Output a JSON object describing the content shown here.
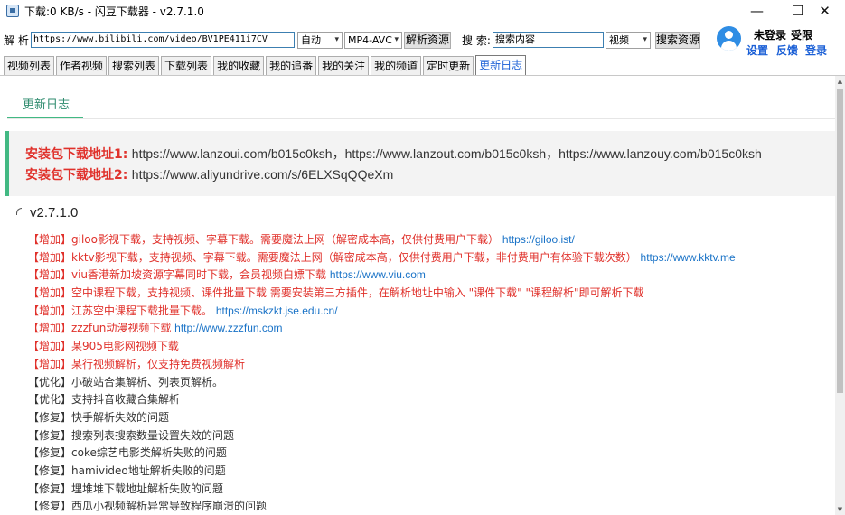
{
  "window": {
    "title": "下载:0 KB/s - 闪豆下载器 - v2.7.1.0",
    "minimize": "—",
    "maximize": "☐",
    "close": "✕"
  },
  "toolbar": {
    "parse_label": "解 析",
    "url_value": "https://www.bilibili.com/video/BV1PE411i7CV",
    "mode_select": "自动",
    "format_select": "MP4-AVC",
    "parse_button": "解析资源",
    "search_label": "搜 索:",
    "search_value": "搜索内容",
    "search_type_select": "视频",
    "search_button": "搜索资源"
  },
  "user": {
    "status": "未登录",
    "limit": "受限",
    "settings": "设置",
    "feedback": "反馈",
    "login": "登录"
  },
  "tabs": [
    {
      "label": "视频列表"
    },
    {
      "label": "作者视频"
    },
    {
      "label": "搜索列表"
    },
    {
      "label": "下载列表"
    },
    {
      "label": "我的收藏"
    },
    {
      "label": "我的追番"
    },
    {
      "label": "我的关注"
    },
    {
      "label": "我的频道"
    },
    {
      "label": "定时更新"
    },
    {
      "label": "更新日志",
      "active": true
    }
  ],
  "content": {
    "subtab": "更新日志",
    "download1_label": "安装包下载地址1:",
    "download1_links": "https://www.lanzoui.com/b015c0ksh，https://www.lanzout.com/b015c0ksh，https://www.lanzouy.com/b015c0ksh",
    "download2_label": "安装包下载地址2:",
    "download2_links": "https://www.aliyundrive.com/s/6ELXSqQQeXm",
    "version": "v2.7.1.0",
    "log": [
      {
        "type": "add",
        "text": "【增加】giloo影视下载，支持视频、字幕下载。需要魔法上网（解密成本高，仅供付费用户下载）",
        "url": "https://giloo.ist/"
      },
      {
        "type": "add",
        "text": "【增加】kktv影视下载，支持视频、字幕下载。需要魔法上网（解密成本高，仅供付费用户下载，非付费用户有体验下载次数）",
        "url": "https://www.kktv.me"
      },
      {
        "type": "add",
        "text": "【增加】viu香港新加坡资源字幕同时下载，会员视频白嫖下载",
        "url": "https://www.viu.com"
      },
      {
        "type": "add",
        "text": "【增加】空中课程下载，支持视频、课件批量下载 需要安装第三方插件，在解析地址中输入 \"课件下载\" \"课程解析\"即可解析下载",
        "url": ""
      },
      {
        "type": "add",
        "text": "【增加】江苏空中课程下载批量下载。",
        "url": "https://mskzkt.jse.edu.cn/"
      },
      {
        "type": "add",
        "text": "【增加】zzzfun动漫视频下载",
        "url": "http://www.zzzfun.com"
      },
      {
        "type": "add",
        "text": "【增加】某905电影网视频下载",
        "url": ""
      },
      {
        "type": "add",
        "text": "【增加】某行视频解析，仅支持免费视频解析",
        "url": ""
      },
      {
        "type": "other",
        "text": "【优化】小破站合集解析、列表页解析。",
        "url": ""
      },
      {
        "type": "other",
        "text": "【优化】支持抖音收藏合集解析",
        "url": ""
      },
      {
        "type": "other",
        "text": "【修复】快手解析失效的问题",
        "url": ""
      },
      {
        "type": "other",
        "text": "【修复】搜索列表搜索数量设置失效的问题",
        "url": ""
      },
      {
        "type": "other",
        "text": "【修复】coke综艺电影类解析失败的问题",
        "url": ""
      },
      {
        "type": "other",
        "text": "【修复】hamivideo地址解析失败的问题",
        "url": ""
      },
      {
        "type": "other",
        "text": "【修复】埋堆堆下载地址解析失败的问题",
        "url": ""
      },
      {
        "type": "other",
        "text": "【修复】西瓜小视频解析异常导致程序崩溃的问题",
        "url": ""
      }
    ]
  },
  "colors": {
    "accent_green": "#42b983",
    "add_red": "#e0312b",
    "link_blue": "#1a73c7"
  }
}
